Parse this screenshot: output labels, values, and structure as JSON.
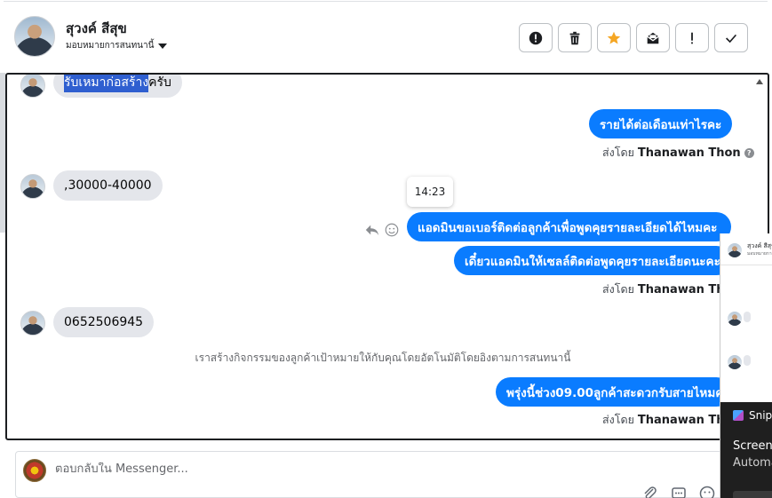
{
  "header": {
    "contact_name": "สุวงค์ สีสุข",
    "assign_label": "มอบหมายการสนทนานี้",
    "actions": [
      {
        "name": "mark-spam-button",
        "icon": "alert-circle-icon"
      },
      {
        "name": "delete-button",
        "icon": "trash-icon"
      },
      {
        "name": "star-button",
        "icon": "star-icon",
        "color": "#f5a623"
      },
      {
        "name": "mark-unread-button",
        "icon": "envelope-open-icon"
      },
      {
        "name": "follow-up-button",
        "icon": "exclamation-icon"
      },
      {
        "name": "mark-done-button",
        "icon": "check-icon"
      }
    ]
  },
  "conversation": {
    "msg1_highlight": "รับเหมาก่อสร้าง",
    "msg1_rest": "ครับ",
    "msg2": "รายได้ต่อเดือนเท่าไรคะ",
    "sent_by_label": "ส่งโดย",
    "sender": "Thanawan Thon",
    "msg3": ",30000-40000",
    "tooltip_time": "14:23",
    "msg4": "แอดมินขอเบอร์ติดต่อลูกค้าเพื่อพูดคุยรายละเอียดได้ไหมคะ",
    "msg5": "เดี๋ยวแอดมินให้เซลล์ติดต่อพูดคุยรายละเอียดนะคะ",
    "msg6": "0652506945",
    "system_note": "เราสร้างกิจกรรมของลูกค้าเป้าหมายให้กับคุณโดยอัตโนมัติโดยอิงตามการสนทนานี้",
    "msg7": "พรุ่งนี้ช่วง09.00ลูกค้าสะดวกรับสายไหมคะ"
  },
  "composer": {
    "placeholder": "ตอบกลับใน Messenger..."
  },
  "overlay": {
    "snip_label": "Snip",
    "line1": "Screens",
    "line2": "Automa"
  },
  "colors": {
    "outgoing_bubble": "#0a7cff",
    "incoming_bubble": "#e4e6eb",
    "selection": "#2f5fd0"
  }
}
